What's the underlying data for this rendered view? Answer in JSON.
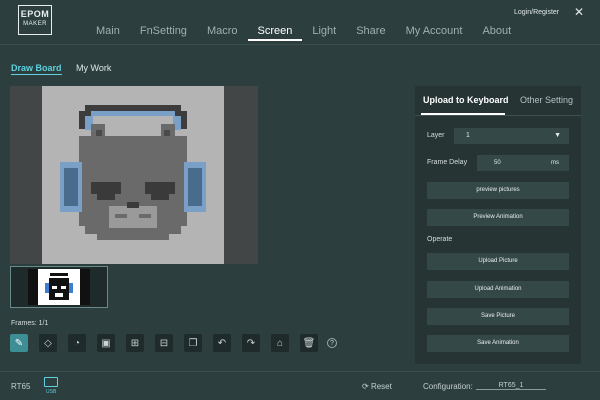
{
  "brand": {
    "line1": "EPOM",
    "line2": "MAKER"
  },
  "nav": {
    "items": [
      {
        "label": "Main"
      },
      {
        "label": "FnSetting"
      },
      {
        "label": "Macro"
      },
      {
        "label": "Screen",
        "active": true
      },
      {
        "label": "Light"
      },
      {
        "label": "Share"
      },
      {
        "label": "My Account"
      },
      {
        "label": "About"
      }
    ]
  },
  "header": {
    "login_label": "Login/Register",
    "close_icon": "close-icon"
  },
  "subtabs": {
    "draw_board": "Draw Board",
    "my_work": "My Work"
  },
  "frames_label": "Frames: 1/1",
  "tools": [
    {
      "icon": "brush-icon",
      "active": true
    },
    {
      "icon": "eraser-icon"
    },
    {
      "icon": "fill-bucket-icon"
    },
    {
      "icon": "image-icon"
    },
    {
      "icon": "add-frame-icon"
    },
    {
      "icon": "remove-frame-icon"
    },
    {
      "icon": "copy-frame-icon"
    },
    {
      "icon": "undo-icon"
    },
    {
      "icon": "redo-icon"
    },
    {
      "icon": "clear-icon"
    },
    {
      "icon": "trash-icon"
    },
    {
      "icon": "help-icon"
    }
  ],
  "panel": {
    "tabs": {
      "upload": "Upload to Keyboard",
      "other": "Other Setting"
    },
    "layer": {
      "label": "Layer",
      "value": "1"
    },
    "frame_delay": {
      "label": "Frame Delay",
      "value": "50",
      "unit": "ms"
    },
    "buttons": {
      "preview_pictures": "preview pictures",
      "preview_animation": "Preview Animation",
      "upload_picture": "Upload Picture",
      "upload_animation": "Upload Animation",
      "save_picture": "Save Picture",
      "save_animation": "Save Animation"
    },
    "operate_label": "Operate"
  },
  "footer": {
    "model": "RT65",
    "usb_label": "USB",
    "reset_label": "Reset",
    "config_label": "Configuration:",
    "config_value": "RT65_1"
  },
  "colors": {
    "background": "#2d3e3e",
    "accent": "#5fd0e0",
    "headphone_blue": "#7aa0c8",
    "panel": "#263434"
  }
}
